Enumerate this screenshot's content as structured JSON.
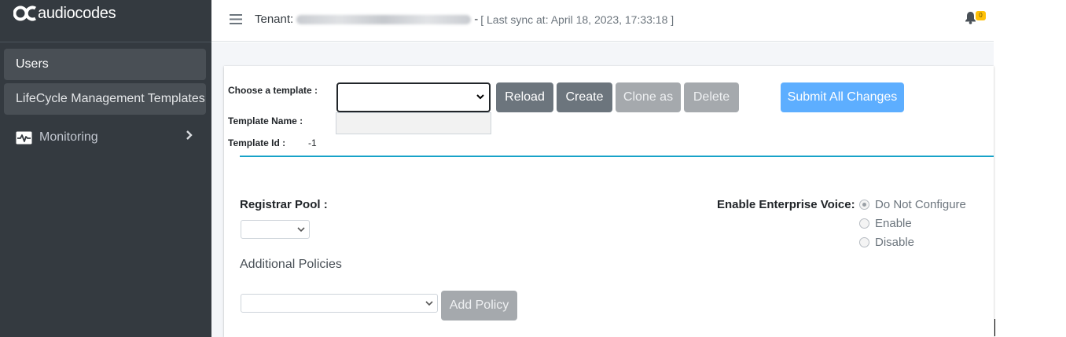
{
  "brand": {
    "logo_text": "audiocodes"
  },
  "sidebar": {
    "items": [
      {
        "label": "Users"
      },
      {
        "label": "LifeCycle Management Templates"
      },
      {
        "label": "Monitoring",
        "icon": "heartbeat-monitor-icon",
        "chevron": "chevron-right-icon"
      }
    ]
  },
  "header": {
    "tenant_label": "Tenant:",
    "tenant_separator": "-",
    "sync_text": "[ Last sync at: April 18, 2023, 17:33:18 ]",
    "notification_count": "0"
  },
  "template_form": {
    "choose_label": "Choose a template :",
    "choose_value": "",
    "name_label": "Template Name :",
    "name_value": "",
    "id_label": "Template Id :",
    "id_value": "-1"
  },
  "buttons": {
    "reload": "Reload",
    "create": "Create",
    "clone": "Clone as",
    "delete": "Delete",
    "submit": "Submit All Changes",
    "add_policy": "Add Policy"
  },
  "settings": {
    "registrar_label": "Registrar Pool :",
    "additional_label": "Additional Policies",
    "voice_label": "Enable Enterprise Voice:",
    "voice_options": [
      {
        "label": "Do Not Configure",
        "checked": true
      },
      {
        "label": "Enable",
        "checked": false
      },
      {
        "label": "Disable",
        "checked": false
      }
    ]
  },
  "colors": {
    "sidebar_bg": "#343a40",
    "secondary_button": "#6c757d",
    "disabled_button": "#a5a9ad",
    "primary_button": "#5daeff",
    "accent_line": "#17a2c8",
    "badge": "#ffc107"
  }
}
